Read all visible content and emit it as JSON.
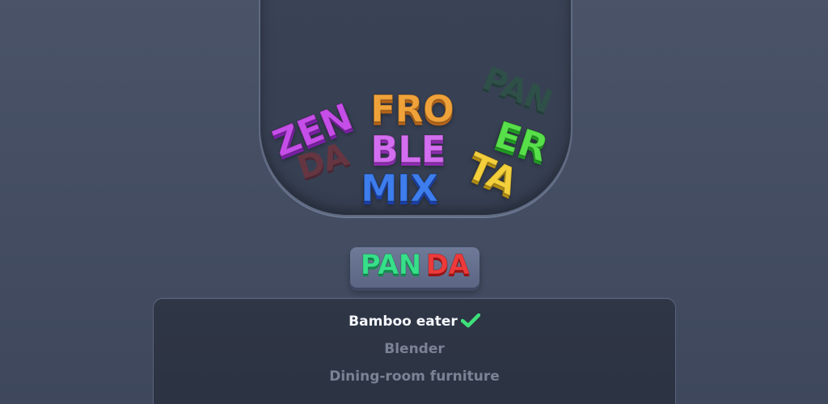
{
  "jar_syllables": [
    {
      "text": "ZEN",
      "color": "purple"
    },
    {
      "text": "DA",
      "color": "dark-red"
    },
    {
      "text": "FRO",
      "color": "orange"
    },
    {
      "text": "BLE",
      "color": "magenta"
    },
    {
      "text": "MIX",
      "color": "blue"
    },
    {
      "text": "PAN",
      "color": "dark-green"
    },
    {
      "text": "ER",
      "color": "green"
    },
    {
      "text": "TA",
      "color": "yellow"
    }
  ],
  "answer": {
    "part1": "PAN",
    "part2": "DA",
    "part1_color": "#36e08a",
    "part2_color": "#ee3a3a"
  },
  "clues": [
    {
      "text": "Bamboo eater",
      "solved": true,
      "icon": "check-icon"
    },
    {
      "text": "Blender",
      "solved": false
    },
    {
      "text": "Dining-room furniture",
      "solved": false
    }
  ],
  "colors": {
    "background": "#464f64",
    "panel": "#2e3545",
    "check": "#3ee07a"
  }
}
